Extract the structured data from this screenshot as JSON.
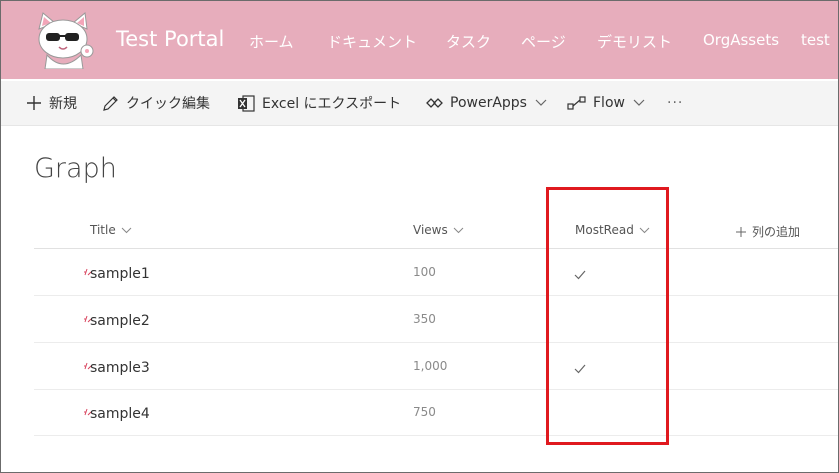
{
  "header": {
    "site_title": "Test Portal",
    "nav": [
      "ホーム",
      "ドキュメント",
      "タスク",
      "ページ",
      "デモリスト",
      "OrgAssets",
      "test"
    ]
  },
  "commandbar": {
    "new_label": "新規",
    "quick_edit_label": "クイック編集",
    "excel_label": "Excel にエクスポート",
    "powerapps_label": "PowerApps",
    "flow_label": "Flow",
    "more_label": "···"
  },
  "list": {
    "title": "Graph",
    "columns": {
      "title": "Title",
      "views": "Views",
      "mostread": "MostRead",
      "add_column": "列の追加"
    },
    "rows": [
      {
        "title": "sample1",
        "views": "100",
        "mostread": true
      },
      {
        "title": "sample2",
        "views": "350",
        "mostread": false
      },
      {
        "title": "sample3",
        "views": "1,000",
        "mostread": true
      },
      {
        "title": "sample4",
        "views": "750",
        "mostread": false
      }
    ]
  },
  "colors": {
    "header_bg": "#e7adbc",
    "highlight": "#e0191f",
    "new_mark": "#d9455f"
  }
}
